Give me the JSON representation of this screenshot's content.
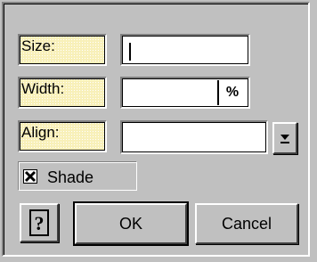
{
  "fields": {
    "size": {
      "label": "Size:",
      "value": ""
    },
    "width": {
      "label": "Width:",
      "value": "",
      "unit": "%"
    },
    "align": {
      "label": "Align:",
      "value": ""
    }
  },
  "shade": {
    "label": "Shade",
    "checked": true
  },
  "buttons": {
    "help_icon": "help-icon",
    "ok": "OK",
    "cancel": "Cancel"
  },
  "dropdown_icon": "dropdown-arrow-icon",
  "colors": {
    "face": "#c0c0c0",
    "label_bg": "#f8f0b8",
    "field_bg": "#ffffff"
  }
}
